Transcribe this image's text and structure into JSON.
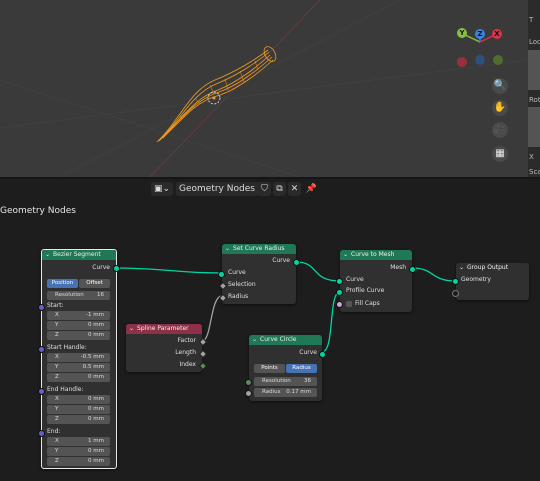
{
  "viewport": {
    "gizmo": {
      "x_label": "X",
      "y_label": "Y",
      "z_label": "Z"
    },
    "tools": {
      "zoom_icon": "🔍",
      "hand_icon": "✋",
      "camera_icon": "🎥",
      "grid_icon": "▦"
    },
    "colors": {
      "curve": "#f29c1d",
      "x_axis": "#d6344c",
      "y_axis": "#87c040",
      "z_axis": "#3a83e0"
    }
  },
  "n_panel": {
    "tab": "T",
    "labels": [
      "Loc",
      "Rot",
      "X",
      "Sca"
    ]
  },
  "header": {
    "editor_icon": "▣",
    "chevron": "⌄",
    "tree_name": "Geometry Nodes",
    "shield_icon": "⛉",
    "copy_icon": "⧉",
    "close_icon": "✕",
    "pin_icon": "📌"
  },
  "breadcrumb": "Geometry Nodes",
  "nodes": {
    "bezier": {
      "title": "Bezier Segment",
      "output_curve": "Curve",
      "mode_position": "Position",
      "mode_offset": "Offset",
      "resolution_label": "Resolution",
      "resolution_value": "16",
      "start_label": "Start:",
      "start": [
        {
          "l": "X",
          "v": "-1 mm"
        },
        {
          "l": "Y",
          "v": "0 mm"
        },
        {
          "l": "Z",
          "v": "0 mm"
        }
      ],
      "start_handle_label": "Start Handle:",
      "start_handle": [
        {
          "l": "X",
          "v": "-0.5 mm"
        },
        {
          "l": "Y",
          "v": "0.5 mm"
        },
        {
          "l": "Z",
          "v": "0 mm"
        }
      ],
      "end_handle_label": "End Handle:",
      "end_handle": [
        {
          "l": "X",
          "v": "0 mm"
        },
        {
          "l": "Y",
          "v": "0 mm"
        },
        {
          "l": "Z",
          "v": "0 mm"
        }
      ],
      "end_label": "End:",
      "end": [
        {
          "l": "X",
          "v": "1 mm"
        },
        {
          "l": "Y",
          "v": "0 mm"
        },
        {
          "l": "Z",
          "v": "0 mm"
        }
      ]
    },
    "set_radius": {
      "title": "Set Curve Radius",
      "output_curve": "Curve",
      "input_curve": "Curve",
      "selection": "Selection",
      "radius": "Radius"
    },
    "spline_param": {
      "title": "Spline Parameter",
      "factor": "Factor",
      "length": "Length",
      "index": "Index"
    },
    "curve_circle": {
      "title": "Curve Circle",
      "output_curve": "Curve",
      "mode_points": "Points",
      "mode_radius": "Radius",
      "resolution_label": "Resolution",
      "resolution_value": "36",
      "radius_label": "Radius",
      "radius_value": "0.17 mm"
    },
    "curve_to_mesh": {
      "title": "Curve to Mesh",
      "output_mesh": "Mesh",
      "curve": "Curve",
      "profile_curve": "Profile Curve",
      "fill_caps": "Fill Caps"
    },
    "group_output": {
      "title": "Group Output",
      "geometry": "Geometry"
    }
  }
}
